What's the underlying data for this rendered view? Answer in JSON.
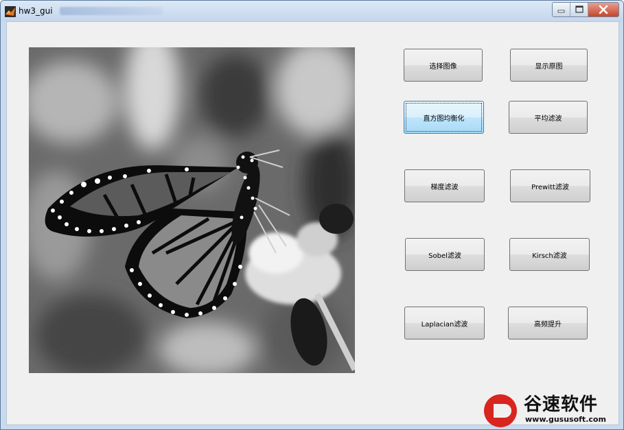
{
  "window": {
    "title": "hw3_gui"
  },
  "buttons": {
    "select_image": "选择图像",
    "show_original": "显示原图",
    "histogram_equalization": "直方图均衡化",
    "mean_filter": "平均滤波",
    "gradient_filter": "梯度滤波",
    "prewitt_filter": "Prewitt滤波",
    "sobel_filter": "Sobel滤波",
    "kirsch_filter": "Kirsch滤波",
    "laplacian_filter": "Laplacian滤波",
    "high_boost": "高频提升"
  },
  "watermark": {
    "name": "谷速软件",
    "url": "www.gususoft.com"
  }
}
